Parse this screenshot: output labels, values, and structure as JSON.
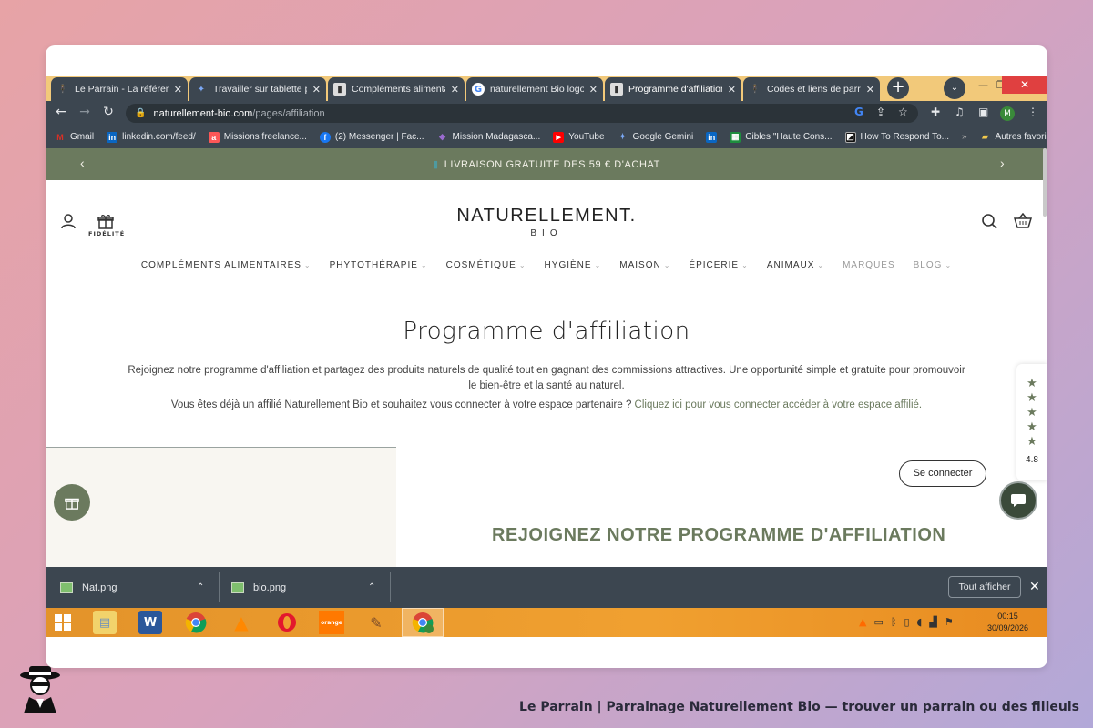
{
  "browser": {
    "tabs": [
      {
        "title": "Le Parrain - La référence",
        "active": false
      },
      {
        "title": "Travailler sur tablette pa",
        "active": false
      },
      {
        "title": "Compléments alimentai",
        "active": false
      },
      {
        "title": "naturellement Bio logo",
        "active": false
      },
      {
        "title": "Programme d'affiliation",
        "active": true
      },
      {
        "title": "Codes et liens de parrai",
        "active": false
      }
    ],
    "url_host": "naturellement-bio.com",
    "url_path": "/pages/affiliation",
    "profile_initial": "M",
    "bookmarks": [
      {
        "label": "Gmail",
        "icon": "gmail-icon",
        "color": "#d93025",
        "glyph": "M"
      },
      {
        "label": "linkedin.com/feed/",
        "icon": "linkedin-icon",
        "color": "#0a66c2",
        "glyph": "in"
      },
      {
        "label": "Missions freelance...",
        "icon": "malt-icon",
        "color": "#fc5757",
        "glyph": "a"
      },
      {
        "label": "(2) Messenger | Fac...",
        "icon": "facebook-icon",
        "color": "#1877f2",
        "glyph": "f"
      },
      {
        "label": "Mission Madagasca...",
        "icon": "mission-icon",
        "color": "#5c3d8a",
        "glyph": "◆"
      },
      {
        "label": "YouTube",
        "icon": "youtube-icon",
        "color": "#ff0000",
        "glyph": "▶"
      },
      {
        "label": "Google Gemini",
        "icon": "gemini-icon",
        "color": "#4f7fe8",
        "glyph": "✦"
      },
      {
        "label": "",
        "icon": "linkedin-icon",
        "color": "#0a66c2",
        "glyph": "in"
      },
      {
        "label": "Cibles \"Haute Cons...",
        "icon": "sheets-icon",
        "color": "#1e8e3e",
        "glyph": "▦"
      },
      {
        "label": "How To Respond To...",
        "icon": "bookmark-page-icon",
        "color": "#222222",
        "glyph": "◩"
      }
    ],
    "other_bookmarks": "Autres favoris"
  },
  "site": {
    "promo": "LIVRAISON GRATUITE DES 59 € D'ACHAT",
    "fidelity_label": "FIDÉLITÉ",
    "logo_main": "NATURELLEMENT.",
    "logo_sub": "BIO",
    "menu": [
      {
        "label": "COMPLÉMENTS ALIMENTAIRES",
        "chevron": true,
        "muted": false
      },
      {
        "label": "PHYTOTHÉRAPIE",
        "chevron": true,
        "muted": false
      },
      {
        "label": "COSMÉTIQUE",
        "chevron": true,
        "muted": false
      },
      {
        "label": "HYGIÈNE",
        "chevron": true,
        "muted": false
      },
      {
        "label": "MAISON",
        "chevron": true,
        "muted": false
      },
      {
        "label": "ÉPICERIE",
        "chevron": true,
        "muted": false
      },
      {
        "label": "ANIMAUX",
        "chevron": true,
        "muted": false
      },
      {
        "label": "MARQUES",
        "chevron": false,
        "muted": true
      },
      {
        "label": "BLOG",
        "chevron": true,
        "muted": true
      }
    ],
    "page_title": "Programme d'affiliation",
    "intro": "Rejoignez notre programme d'affiliation et partagez des produits naturels de qualité tout en gagnant des commissions attractives. Une opportunité simple et gratuite pour promouvoir le bien-être et la santé au naturel.",
    "login_text": "Vous êtes déjà un affilié Naturellement Bio et souhaitez vous connecter à votre espace partenaire ?",
    "login_link": "Cliquez ici pour vous connecter accéder à votre espace affilié.",
    "connect_button": "Se connecter",
    "join_heading": "REJOIGNEZ NOTRE PROGRAMME D'AFFILIATION",
    "rating_value": "4.8",
    "rating_stars": 5,
    "accent_color": "#6b7a5e"
  },
  "downloads": {
    "items": [
      {
        "name": "Nat.png"
      },
      {
        "name": "bio.png"
      }
    ],
    "show_all": "Tout afficher"
  },
  "taskbar": {
    "time": "00:15",
    "date": "30/09/2026",
    "apps": [
      "windows-start-icon",
      "file-explorer-icon",
      "word-icon",
      "chrome-icon",
      "vlc-icon",
      "opera-icon",
      "orange-icon",
      "paint-icon",
      "chrome-profile-icon"
    ],
    "orange_label": "orange"
  },
  "footer": {
    "caption": "Le Parrain | Parrainage Naturellement Bio — trouver un parrain ou des filleuls"
  }
}
